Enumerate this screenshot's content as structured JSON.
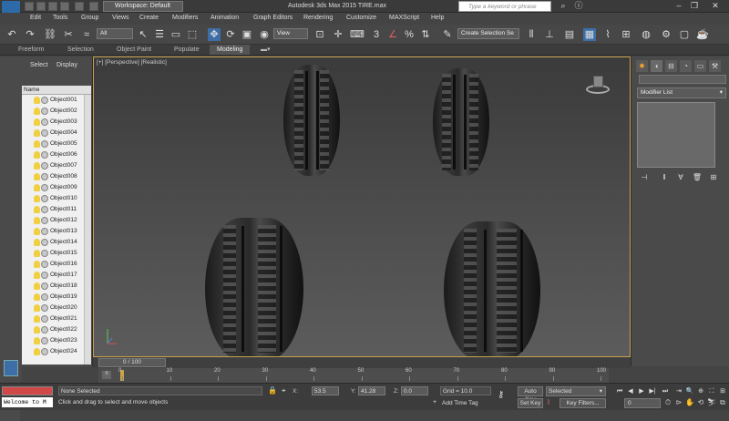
{
  "titlebar": {
    "logo_text": "MAX",
    "workspace": "Workspace: Default",
    "title": "Autodesk 3ds Max  2015     TIRE.max",
    "search_placeholder": "Type a keyword or phrase"
  },
  "menu": [
    "Edit",
    "Tools",
    "Group",
    "Views",
    "Create",
    "Modifiers",
    "Animation",
    "Graph Editors",
    "Rendering",
    "Customize",
    "MAXScript",
    "Help"
  ],
  "toolbar": {
    "filter": "All",
    "ref_coord": "View",
    "selection_set": "Create Selection Se"
  },
  "ribbon": [
    "Freeform",
    "Selection",
    "Object Paint",
    "Populate",
    "Modeling"
  ],
  "explorer": {
    "tabs": [
      "Select",
      "Display"
    ],
    "column_header": "Name",
    "objects": [
      "Object001",
      "Object002",
      "Object003",
      "Object004",
      "Object005",
      "Object006",
      "Object007",
      "Object008",
      "Object009",
      "Object010",
      "Object011",
      "Object012",
      "Object013",
      "Object014",
      "Object015",
      "Object016",
      "Object017",
      "Object018",
      "Object019",
      "Object020",
      "Object021",
      "Object022",
      "Object023",
      "Object024"
    ]
  },
  "viewport": {
    "label": "[+] [Perspective] [Realistic]"
  },
  "command_panel": {
    "modifier_list": "Modifier List"
  },
  "timeline": {
    "slider": "0 / 100",
    "ticks": [
      "0",
      "10",
      "20",
      "30",
      "40",
      "50",
      "60",
      "70",
      "80",
      "90",
      "100"
    ]
  },
  "status": {
    "selection": "None Selected",
    "prompt": "Click and drag to select and move objects",
    "maxscript_welcome": "Welcome to M",
    "x_label": "X:",
    "x_value": "53.5",
    "y_label": "Y:",
    "y_value": "41.28",
    "z_label": "Z:",
    "z_value": "0.0",
    "grid": "Grid = 10.0",
    "time_tag": "Add Time Tag",
    "auto_key": "Auto Key",
    "set_key": "Set Key",
    "selected": "Selected",
    "key_filters": "Key Filters...",
    "frame": "0"
  },
  "colors": {
    "viewport_border": "#c7a24a",
    "accent_blue": "#2d6aa8"
  }
}
